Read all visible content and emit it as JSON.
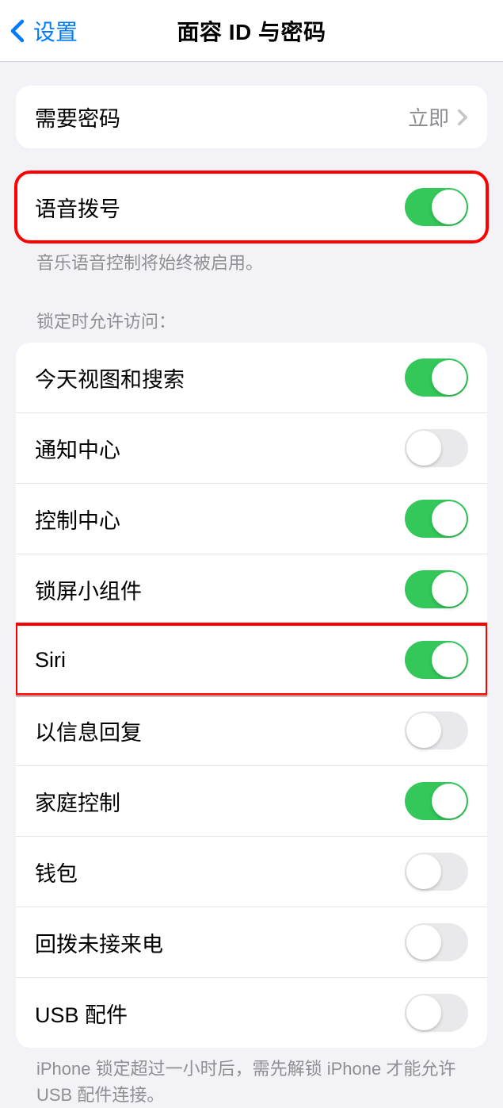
{
  "nav": {
    "back_label": "设置",
    "title": "面容 ID 与密码"
  },
  "require_passcode": {
    "label": "需要密码",
    "value": "立即"
  },
  "voice_dial": {
    "label": "语音拨号",
    "on": true,
    "footer": "音乐语音控制将始终被启用。"
  },
  "lockscreen": {
    "header": "锁定时允许访问：",
    "items": [
      {
        "label": "今天视图和搜索",
        "on": true
      },
      {
        "label": "通知中心",
        "on": false
      },
      {
        "label": "控制中心",
        "on": true
      },
      {
        "label": "锁屏小组件",
        "on": true
      },
      {
        "label": "Siri",
        "on": true
      },
      {
        "label": "以信息回复",
        "on": false
      },
      {
        "label": "家庭控制",
        "on": true
      },
      {
        "label": "钱包",
        "on": false
      },
      {
        "label": "回拨未接来电",
        "on": false
      },
      {
        "label": "USB 配件",
        "on": false
      }
    ],
    "footer": "iPhone 锁定超过一小时后，需先解锁 iPhone 才能允许USB 配件连接。"
  }
}
